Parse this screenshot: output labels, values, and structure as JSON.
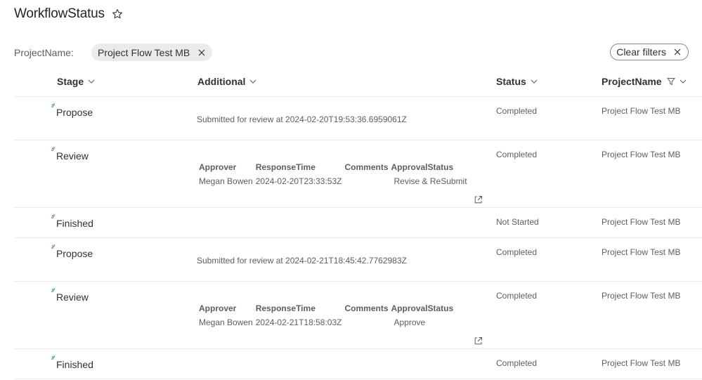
{
  "header": {
    "title": "WorkflowStatus"
  },
  "filters": {
    "label": "ProjectName:",
    "active_value": "Project Flow Test MB",
    "clear_label": "Clear filters"
  },
  "columns": {
    "stage": "Stage",
    "additional": "Additional",
    "status": "Status",
    "project": "ProjectName"
  },
  "approval_headers": {
    "approver": "Approver",
    "response_time": "ResponseTime",
    "comments": "Comments",
    "approval_status": "ApprovalStatus"
  },
  "rows": [
    {
      "stage": "Propose",
      "additional": "Submitted for review at 2024-02-20T19:53:36.6959061Z",
      "status": "Completed",
      "project": "Project Flow Test MB"
    },
    {
      "stage": "Review",
      "approver": "Megan Bowen",
      "response_time": "2024-02-20T23:33:53Z",
      "comments": "",
      "approval_status": "Revise & ReSubmit",
      "status": "Completed",
      "project": "Project Flow Test MB"
    },
    {
      "stage": "Finished",
      "additional": "",
      "status": "Not Started",
      "project": "Project Flow Test MB"
    },
    {
      "stage": "Propose",
      "additional": "Submitted for review at 2024-02-21T18:45:42.7762983Z",
      "status": "Completed",
      "project": "Project Flow Test MB"
    },
    {
      "stage": "Review",
      "approver": "Megan Bowen",
      "response_time": "2024-02-21T18:58:03Z",
      "comments": "",
      "approval_status": "Approve",
      "status": "Completed",
      "project": "Project Flow Test MB"
    },
    {
      "stage": "Finished",
      "additional": "",
      "status": "Completed",
      "project": "Project Flow Test MB"
    }
  ],
  "icons": {
    "title_favorite": "star-icon",
    "filter_remove": "close-icon",
    "sort": "chevron-down-icon",
    "filter_applied": "filter-icon",
    "stage_status": "spinner-icon",
    "open_details": "open-in-new-window-icon"
  },
  "colors": {
    "spinner_accent": "#107c10"
  }
}
